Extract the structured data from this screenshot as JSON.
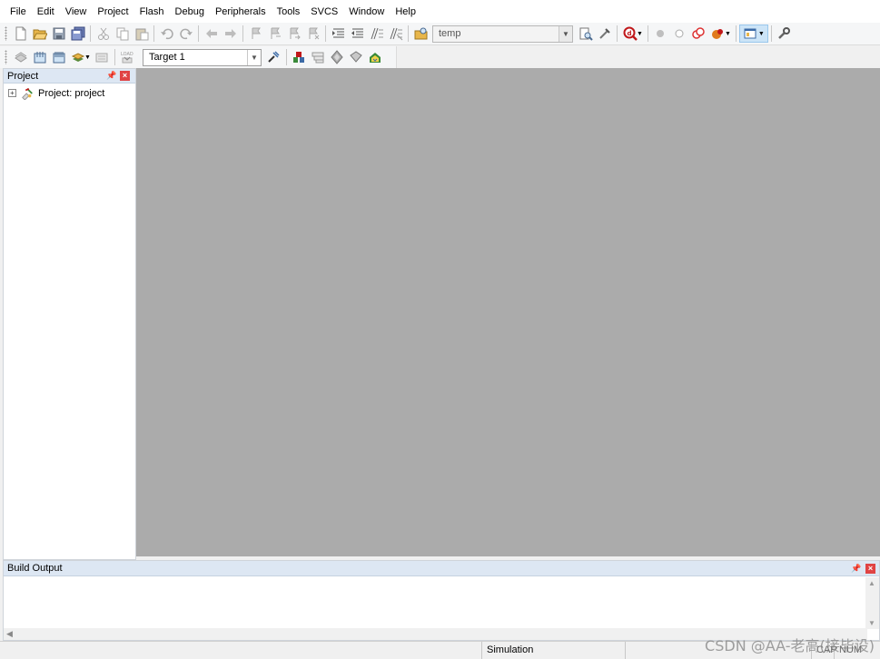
{
  "menubar": {
    "items": [
      "File",
      "Edit",
      "View",
      "Project",
      "Flash",
      "Debug",
      "Peripherals",
      "Tools",
      "SVCS",
      "Window",
      "Help"
    ]
  },
  "toolbar1": {
    "find_combo_value": "temp",
    "icons": [
      "new-file-icon",
      "open-folder-icon",
      "save-icon",
      "save-all-icon",
      "cut-icon",
      "copy-icon",
      "paste-icon",
      "undo-icon",
      "redo-icon",
      "navigate-back-icon",
      "navigate-forward-icon",
      "bookmark-icon",
      "prev-bookmark-icon",
      "next-bookmark-icon",
      "clear-bookmarks-icon",
      "indent-icon",
      "unindent-icon",
      "comment-icon",
      "uncomment-icon",
      "find-in-files-icon",
      "find-icon",
      "incremental-find-icon",
      "start-debug-icon",
      "breakpoint-icon",
      "disable-breakpoint-icon",
      "kill-breakpoints-icon",
      "kill-all-icon",
      "window-layout-icon",
      "configure-icon"
    ]
  },
  "toolbar2": {
    "target_value": "Target 1",
    "icons": [
      "translate-icon",
      "build-icon",
      "rebuild-icon",
      "batch-build-icon",
      "stop-build-icon",
      "download-icon",
      "target-options-icon",
      "file-extensions-icon",
      "manage-project-icon",
      "select-packs-icon",
      "manage-run-time-icon",
      "pack-installer-icon"
    ]
  },
  "project_panel": {
    "title": "Project",
    "tree_root": "Project: project",
    "expander": "+"
  },
  "build_output": {
    "title": "Build Output"
  },
  "status": {
    "mode": "Simulation",
    "caps": "CAP",
    "num": "NUM"
  },
  "watermark": "CSDN @AA-老高(接毕设)",
  "colors": {
    "editor_bg": "#ababab",
    "panel_title_bg": "#dde7f3",
    "close_button": "#e04343"
  }
}
